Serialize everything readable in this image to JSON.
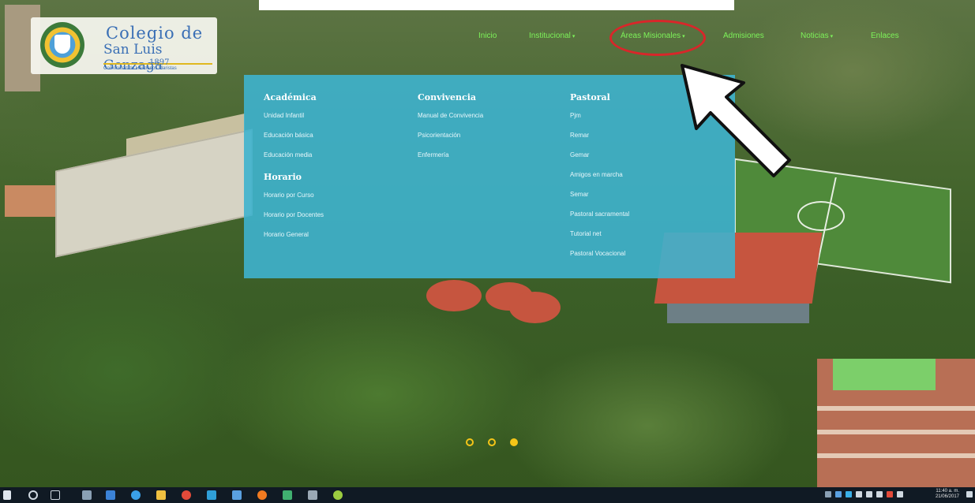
{
  "header": {
    "logo": {
      "line1": "Colegio de",
      "line2": "San Luis Gonzaga",
      "year": "1897",
      "tagline": "Comunidad de Hermanos Maristas"
    },
    "nav_items": [
      {
        "label": "Inicio",
        "has_caret": false
      },
      {
        "label": "Institucional",
        "has_caret": true
      },
      {
        "label": "Áreas Misionales",
        "has_caret": true,
        "highlighted": true
      },
      {
        "label": "Admisiones",
        "has_caret": false
      },
      {
        "label": "Noticias",
        "has_caret": true
      },
      {
        "label": "Enlaces",
        "has_caret": false
      }
    ]
  },
  "mega_menu": {
    "columns": [
      {
        "heading": "Académica",
        "items": [
          "Unidad Infantil",
          "Educación básica",
          "Educación media"
        ],
        "subsection": {
          "heading": "Horario",
          "items": [
            "Horario por Curso",
            "Horario por Docentes",
            "Horario General"
          ]
        }
      },
      {
        "heading": "Convivencia",
        "items": [
          "Manual de Convivencia",
          "Psicorientación",
          "Enfermería"
        ]
      },
      {
        "heading": "Pastoral",
        "items": [
          "Pjm",
          "Remar",
          "Gemar",
          "Amigos en marcha",
          "Semar",
          "Pastoral sacramental",
          "Tutorial net",
          "Pastoral Vocacional"
        ]
      }
    ]
  },
  "slider": {
    "dot_count": 3,
    "active_index": 2
  },
  "taskbar": {
    "time": "11:40 a. m.",
    "date": "21/06/2017"
  },
  "colors": {
    "nav_text": "#7df35a",
    "menu_bg": "#3eb2ce",
    "highlight": "#d9262a",
    "dot": "#f5c518"
  }
}
